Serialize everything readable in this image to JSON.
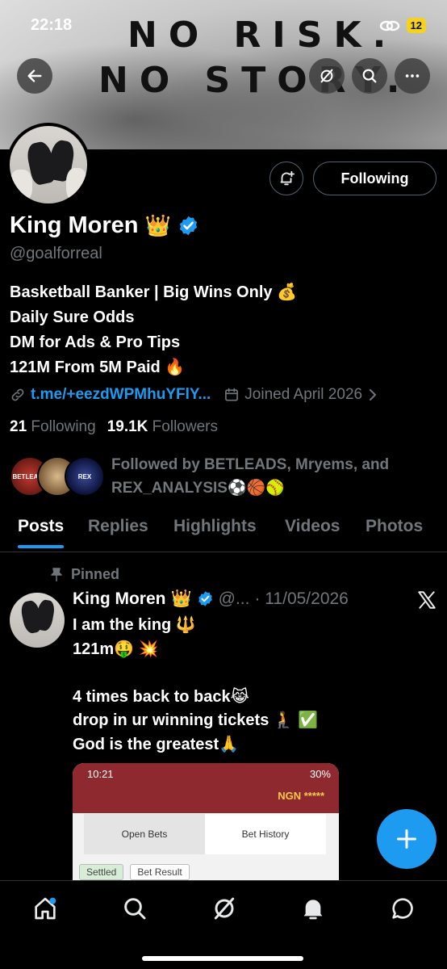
{
  "status_bar": {
    "time": "22:18",
    "battery": "12"
  },
  "banner": {
    "line1": "NO RISK.",
    "line2": "NO STORY."
  },
  "profile": {
    "following_label": "Following",
    "display_name": "King Moren",
    "crown": "👑",
    "handle": "@goalforreal",
    "bio": [
      "Basketball Banker | Big Wins Only 💰",
      "Daily Sure Odds",
      "DM for Ads & Pro Tips",
      "121M From 5M Paid 🔥"
    ],
    "link": "t.me/+eezdWPMhuYFlY...",
    "joined": "Joined April 2026",
    "following_count": "21",
    "following_label_text": "Following",
    "followers_count": "19.1K",
    "followers_label_text": "Followers",
    "followed_by": "Followed by BETLEADS, Mryems, and REX_ANALYSIS⚽🏀🥎",
    "mini_avatars": [
      "BETLEADS",
      "",
      "REX"
    ]
  },
  "tabs": [
    "Posts",
    "Replies",
    "Highlights",
    "Videos",
    "Photos"
  ],
  "post": {
    "pinned_label": "Pinned",
    "name": "King Moren",
    "crown": "👑",
    "handle": "@...",
    "date": "· 11/05/2026",
    "lines": [
      "I am the king 🔱",
      "121m🤑 💥",
      "",
      "4 times back to back😹",
      "drop in ur winning tickets 🧎 ✅",
      "God is the greatest🙏"
    ],
    "media": {
      "time": "10:21",
      "status_right": "30%",
      "ngn": "NGN *****",
      "tab_open": "Open Bets",
      "tab_history": "Bet History",
      "filter_settled": "Settled",
      "filter_result": "Bet Result"
    }
  },
  "colors": {
    "accent": "#1d9bf0",
    "muted": "#71767b",
    "background": "#000000"
  },
  "nav_icons": [
    "home-icon",
    "search-icon",
    "grok-icon",
    "notifications-icon",
    "messages-icon"
  ]
}
